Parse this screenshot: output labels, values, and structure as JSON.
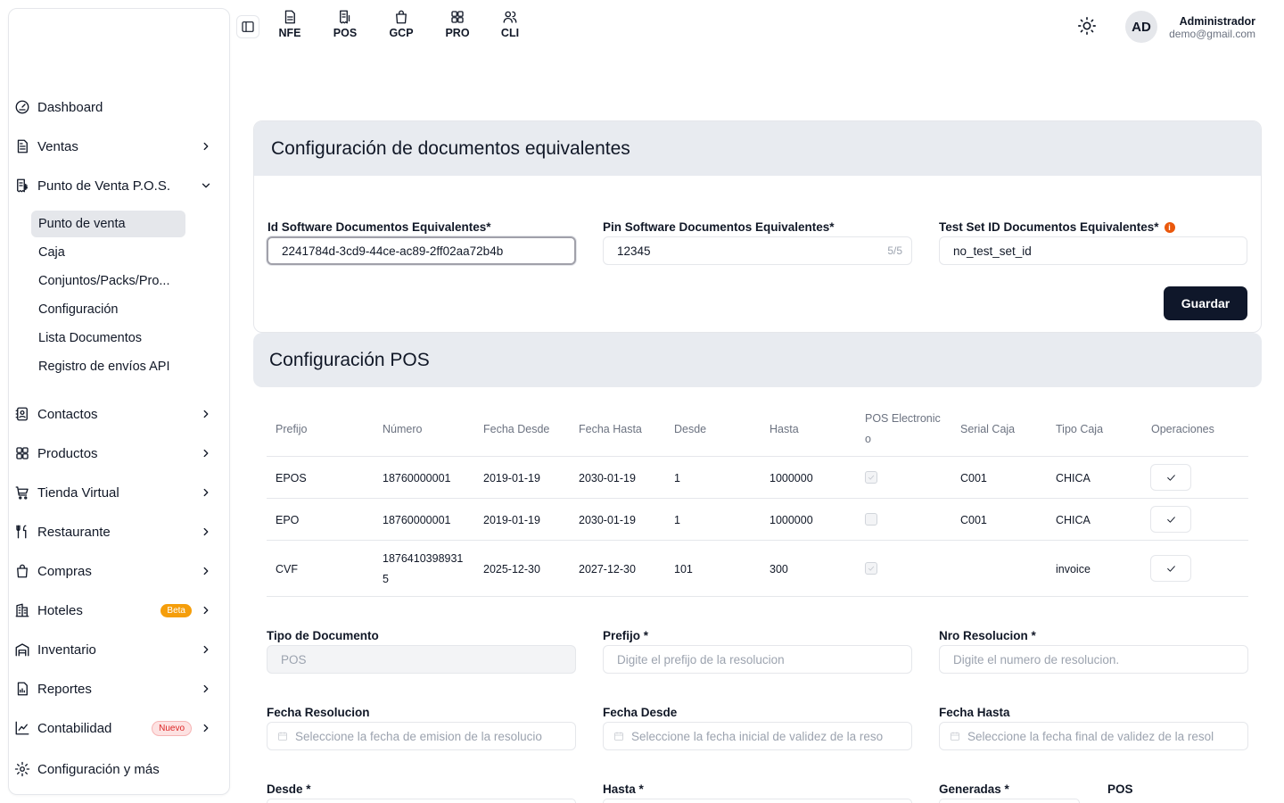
{
  "sidebar": {
    "items": [
      {
        "label": "Dashboard",
        "icon": "gauge-icon"
      },
      {
        "label": "Ventas",
        "icon": "document-icon"
      },
      {
        "label": "Punto de Venta P.O.S.",
        "icon": "pos-receipt-icon"
      },
      {
        "label": "Contactos",
        "icon": "contacts-icon"
      },
      {
        "label": "Productos",
        "icon": "grid-icon"
      },
      {
        "label": "Tienda Virtual",
        "icon": "cart-icon"
      },
      {
        "label": "Restaurante",
        "icon": "utensils-icon"
      },
      {
        "label": "Compras",
        "icon": "shopping-bag-icon"
      },
      {
        "label": "Hoteles",
        "icon": "hotel-icon",
        "badge": "Beta"
      },
      {
        "label": "Inventario",
        "icon": "warehouse-icon"
      },
      {
        "label": "Reportes",
        "icon": "report-icon"
      },
      {
        "label": "Contabilidad",
        "icon": "chart-icon",
        "badge": "Nuevo"
      },
      {
        "label": "Configuración y más",
        "icon": "gear-icon"
      }
    ],
    "pos_submenu": [
      {
        "label": "Punto de venta",
        "active": true
      },
      {
        "label": "Caja"
      },
      {
        "label": "Conjuntos/Packs/Pro..."
      },
      {
        "label": "Configuración"
      },
      {
        "label": "Lista Documentos"
      },
      {
        "label": "Registro de envíos API"
      }
    ]
  },
  "topbar": {
    "nav": [
      {
        "label": "NFE",
        "icon": "invoice-icon"
      },
      {
        "label": "POS",
        "icon": "pos-icon"
      },
      {
        "label": "GCP",
        "icon": "bag-icon"
      },
      {
        "label": "PRO",
        "icon": "grid-icon"
      },
      {
        "label": "CLI",
        "icon": "users-icon"
      }
    ],
    "avatar_initials": "AD",
    "user_name": "Administrador",
    "user_email": "demo@gmail.com"
  },
  "equiv_section": {
    "title": "Configuración de documentos equivalentes",
    "software_id_label": "Id Software Documentos Equivalentes*",
    "software_id_value": "2241784d-3cd9-44ce-ac89-2ff02aa72b4b",
    "pin_label": "Pin Software Documentos Equivalentes*",
    "pin_value": "12345",
    "pin_count": "5/5",
    "test_set_label": "Test Set ID Documentos Equivalentes*",
    "test_set_info": "i",
    "test_set_value": "no_test_set_id",
    "save_label": "Guardar"
  },
  "pos_section": {
    "title": "Configuración POS",
    "columns": [
      "Prefijo",
      "Número",
      "Fecha Desde",
      "Fecha Hasta",
      "Desde",
      "Hasta",
      "POS Electronic",
      "o",
      "Serial Caja",
      "Tipo Caja",
      "Operaciones"
    ],
    "rows": [
      {
        "prefijo": "EPOS",
        "numero": "18760000001",
        "numero2": "",
        "fecha_desde": "2019-01-19",
        "fecha_hasta": "2030-01-19",
        "desde": "1",
        "hasta": "1000000",
        "pos_electronico": true,
        "serial": "C001",
        "tipo": "CHICA"
      },
      {
        "prefijo": "EPO",
        "numero": "18760000001",
        "numero2": "",
        "fecha_desde": "2019-01-19",
        "fecha_hasta": "2030-01-19",
        "desde": "1",
        "hasta": "1000000",
        "pos_electronico": false,
        "serial": "C001",
        "tipo": "CHICA"
      },
      {
        "prefijo": "CVF",
        "numero": "1876410398931",
        "numero2": "5",
        "fecha_desde": "2025-12-30",
        "fecha_hasta": "2027-12-30",
        "desde": "101",
        "hasta": "300",
        "pos_electronico": true,
        "serial": "",
        "tipo": "invoice"
      }
    ]
  },
  "form": {
    "tipo_documento_label": "Tipo de Documento",
    "tipo_documento_value": "POS",
    "prefijo_label": "Prefijo *",
    "prefijo_placeholder": "Digite el prefijo de la resolucion",
    "nro_resolucion_label": "Nro Resolucion *",
    "nro_resolucion_placeholder": "Digite el numero de resolucion.",
    "fecha_resolucion_label": "Fecha Resolucion",
    "fecha_resolucion_placeholder": "Seleccione la fecha de emision de la resolucio",
    "fecha_desde_label": "Fecha Desde",
    "fecha_desde_placeholder": "Seleccione la fecha inicial de validez de la reso",
    "fecha_hasta_label": "Fecha Hasta",
    "fecha_hasta_placeholder": "Seleccione la fecha final de validez de la resol",
    "desde_label": "Desde *",
    "hasta_label": "Hasta *",
    "generadas_label": "Generadas *",
    "pos_label": "POS"
  }
}
